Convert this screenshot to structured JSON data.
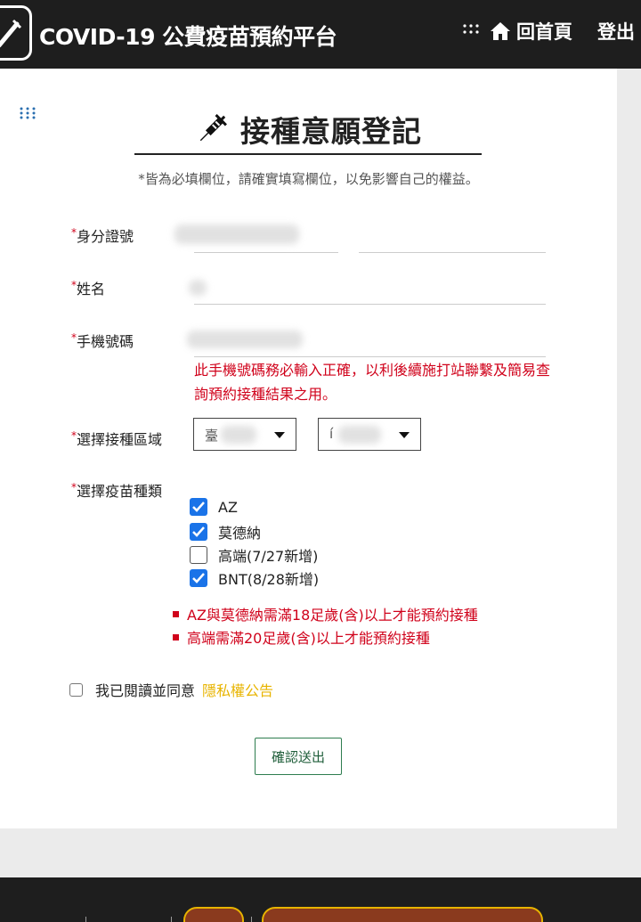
{
  "header": {
    "title": "COVID-19 公費疫苗預約平台",
    "home_label": "回首頁",
    "logout_label": "登出"
  },
  "form": {
    "heading": "接種意願登記",
    "notice": "*皆為必填欄位，請確實填寫欄位，以免影響自己的權益。",
    "id_label": "身分證號",
    "name_label": "姓名",
    "phone_label": "手機號碼",
    "phone_warning": "此手機號碼務必輸入正確，以利後續施打站聯繫及簡易查詢預約接種結果之用。",
    "region_label": "選擇接種區域",
    "region_city_value": "臺",
    "region_district_value": "í",
    "vaccine_label": "選擇疫苗種類",
    "required_mark": "*",
    "vaccines": [
      {
        "label": "AZ",
        "checked": true
      },
      {
        "label": "莫德納",
        "checked": true
      },
      {
        "label": "高端(7/27新增)",
        "checked": false
      },
      {
        "label": "BNT(8/28新增)",
        "checked": true
      }
    ],
    "rules": [
      "AZ與莫德納需滿18足歲(含)以上才能預約接種",
      "高端需滿20足歲(含)以上才能預約接種"
    ],
    "agree_text": "我已閱讀並同意",
    "privacy_link": "隱私權公告",
    "submit_label": "確認送出"
  },
  "colors": {
    "accent_red": "#d0021b",
    "checkbox_blue": "#1a73e8",
    "link_yellow": "#e8b400",
    "submit_green": "#2e7d4f"
  }
}
